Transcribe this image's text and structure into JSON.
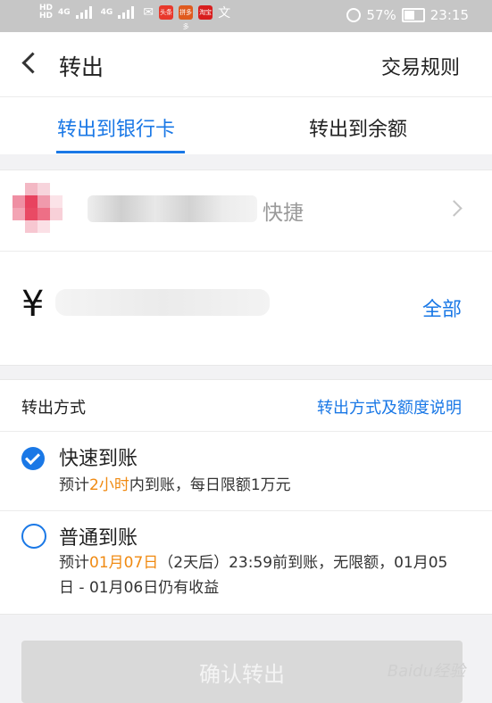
{
  "status_bar": {
    "battery": "57%",
    "time": "23:15",
    "network": [
      "4G",
      "4G"
    ],
    "hd_labels": [
      "HD",
      "HD"
    ],
    "app_icons": [
      "头条",
      "拼多多",
      "淘宝"
    ]
  },
  "header": {
    "title": "转出",
    "rules_label": "交易规则"
  },
  "tabs": [
    {
      "label": "转出到银行卡",
      "active": true
    },
    {
      "label": "转出到余额",
      "active": false
    }
  ],
  "bank_card": {
    "quick_label": "快捷"
  },
  "amount": {
    "currency_symbol": "¥",
    "all_label": "全部"
  },
  "method": {
    "label": "转出方式",
    "explain_link": "转出方式及额度说明",
    "options": [
      {
        "title": "快速到账",
        "selected": true,
        "desc_prefix": "预计",
        "desc_highlight": "2小时",
        "desc_suffix": "内到账，每日限额1万元"
      },
      {
        "title": "普通到账",
        "selected": false,
        "desc_prefix": "预计",
        "desc_highlight": "01月07日",
        "desc_suffix": "（2天后）23:59前到账，无限额，01月05日 - 01月06日仍有收益"
      }
    ]
  },
  "confirm_button": "确认转出",
  "watermark": "Baidu经验",
  "colors": {
    "accent": "#1a78e6",
    "highlight": "#f08a12",
    "disabled_button": "#d9d9d9"
  }
}
